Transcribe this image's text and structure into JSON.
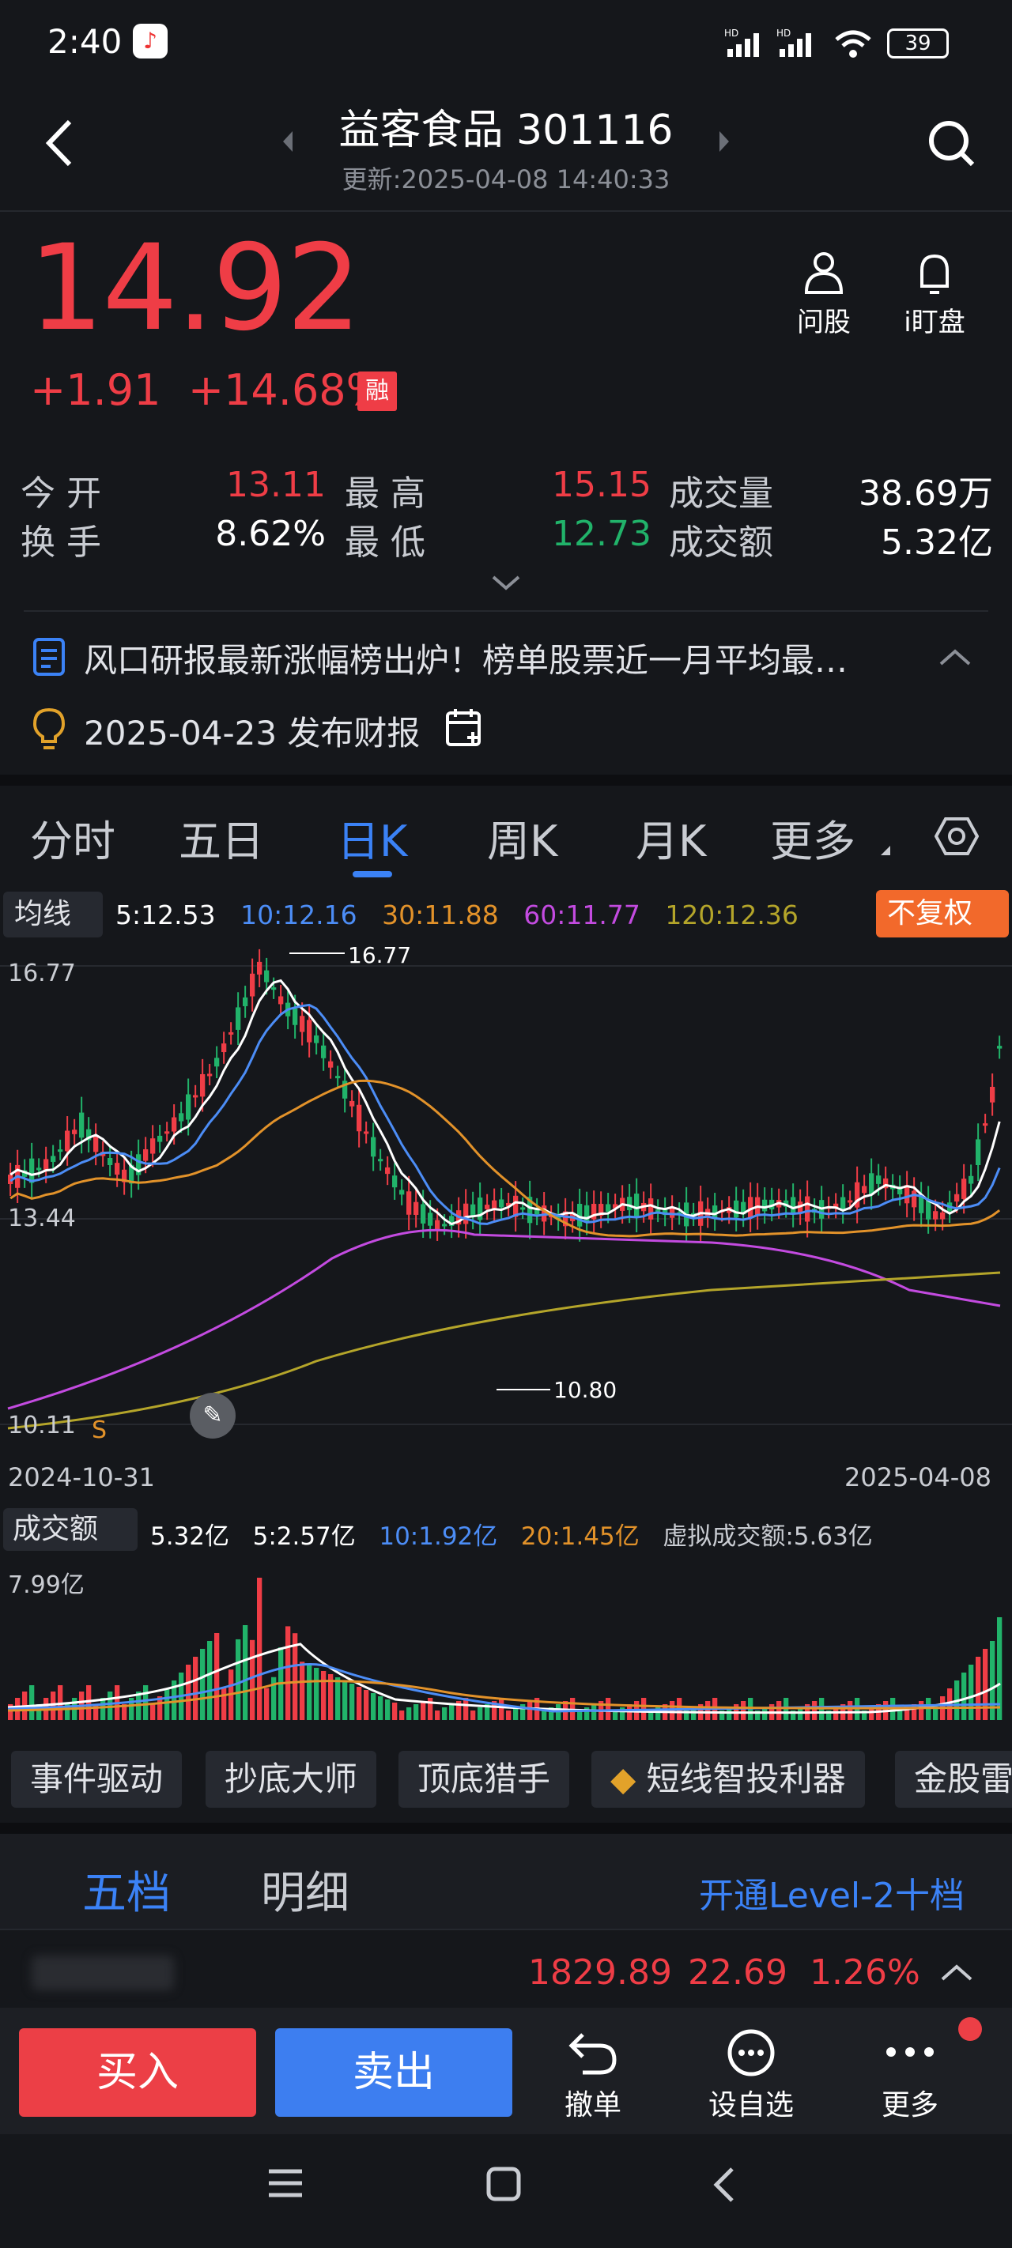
{
  "status": {
    "time": "2:40",
    "battery": "39"
  },
  "header": {
    "title": "益客食品 301116",
    "updated": "更新:2025-04-08 14:40:33"
  },
  "quote": {
    "price": "14.92",
    "change": "+1.91",
    "change_pct": "+14.68%",
    "tag": "融",
    "open_label": "今 开",
    "open": "13.11",
    "high_label": "最 高",
    "high": "15.15",
    "vol_label": "成交量",
    "vol": "38.69万",
    "turnover_label": "换 手",
    "turnover": "8.62%",
    "low_label": "最 低",
    "low": "12.73",
    "amount_label": "成交额",
    "amount": "5.32亿"
  },
  "actions": {
    "ask": "问股",
    "watch": "i盯盘"
  },
  "news": {
    "headline": "风口研报最新涨幅榜出炉！榜单股票近一月平均最…",
    "report": "2025-04-23 发布财报"
  },
  "tabs": [
    "分时",
    "五日",
    "日K",
    "周K",
    "月K",
    "更多"
  ],
  "ma_bar": {
    "label": "均线",
    "ma5": "5:12.53",
    "ma10": "10:12.16",
    "ma30": "30:11.88",
    "ma60": "60:11.77",
    "ma120": "120:12.36",
    "adjust": "不复权"
  },
  "colors": {
    "up": "#ef3d46",
    "down": "#21b36a",
    "ma5": "#ffffff",
    "ma10": "#4c8df6",
    "ma30": "#e2922a",
    "ma60": "#c34be0",
    "ma120": "#b4a52a",
    "accent": "#3b82f6"
  },
  "chart_data": {
    "type": "candlestick",
    "y_axis_labels": [
      "16.77",
      "13.44",
      "10.11"
    ],
    "high_marker": "16.77",
    "low_marker": "10.80",
    "start_date": "2024-10-31",
    "end_date": "2025-04-08",
    "signal": "S"
  },
  "volume_bar": {
    "label": "成交额",
    "value": "5.32亿",
    "ma5": "5:2.57亿",
    "ma10": "10:1.92亿",
    "ma20": "20:1.45亿",
    "virtual": "虚拟成交额:5.63亿",
    "max": "7.99亿"
  },
  "tools": [
    "事件驱动",
    "抄底大师",
    "顶底猎手",
    "短线智投利器",
    "金股雷"
  ],
  "depth": {
    "tab1": "五档",
    "tab2": "明细",
    "level2": "开通Level-2十档"
  },
  "index_row": {
    "value": "1829.89",
    "change": "22.69",
    "pct": "1.26%"
  },
  "bottom": {
    "buy": "买入",
    "sell": "卖出",
    "cancel": "撤单",
    "watchlist": "设自选",
    "more": "更多"
  }
}
